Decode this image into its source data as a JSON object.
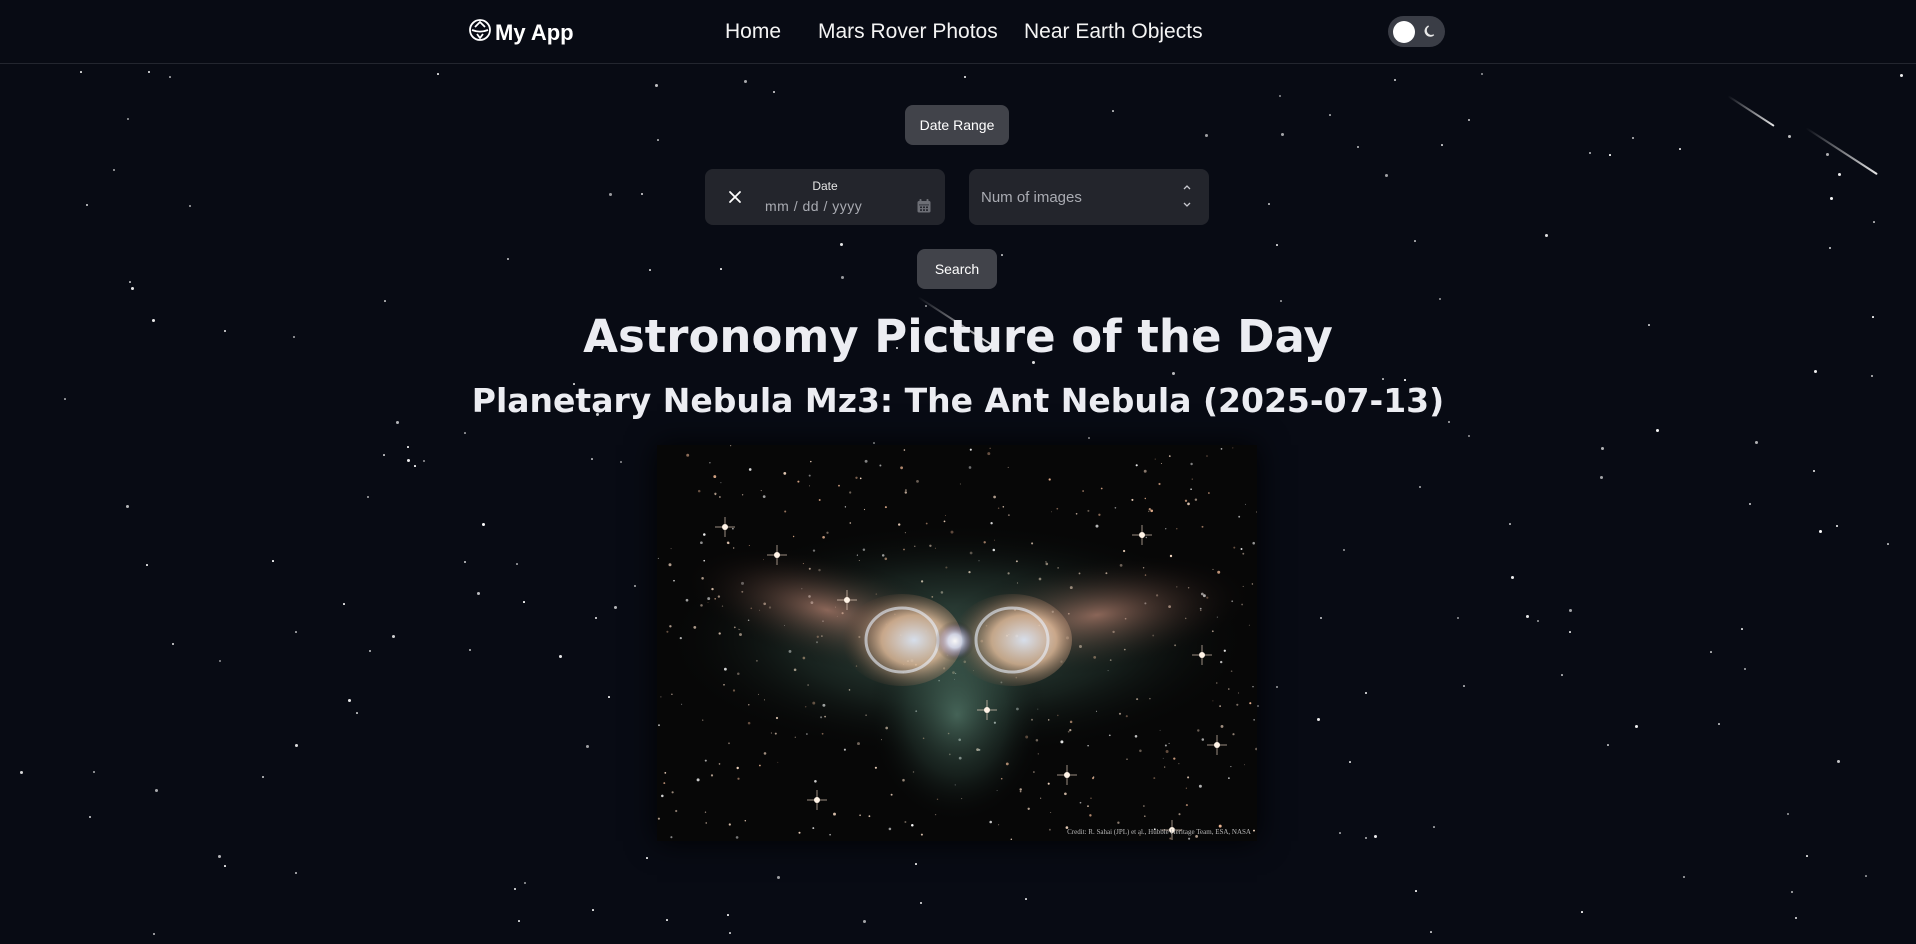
{
  "navbar": {
    "brand": "My App",
    "brand_icon": "nasa-orbit-logo-icon",
    "links": [
      "Home",
      "Mars Rover Photos",
      "Near Earth Objects"
    ],
    "theme_toggle": {
      "icon": "moon-icon",
      "state": "light-knob-left"
    }
  },
  "controls": {
    "date_range_button": "Date Range",
    "date_field": {
      "label": "Date",
      "placeholder": "mm / dd / yyyy",
      "clear_icon": "close-icon",
      "calendar_icon": "calendar-icon"
    },
    "num_images_field": {
      "placeholder": "Num of images",
      "stepper_icons": [
        "chevron-up-icon",
        "chevron-down-icon"
      ]
    },
    "search_button": "Search"
  },
  "apod": {
    "heading": "Astronomy Picture of the Day",
    "title": "Planetary Nebula Mz3: The Ant Nebula (2025-07-13)",
    "image_alt": "Planetary Nebula Mz3: The Ant Nebula",
    "credit": "Credit: R. Sahai (JPL) et al., Hubble Heritage Team, ESA, NASA"
  },
  "colors": {
    "background": "#080b14",
    "button": "#41434a",
    "field": "#23252c",
    "text": "#ecedf2"
  }
}
